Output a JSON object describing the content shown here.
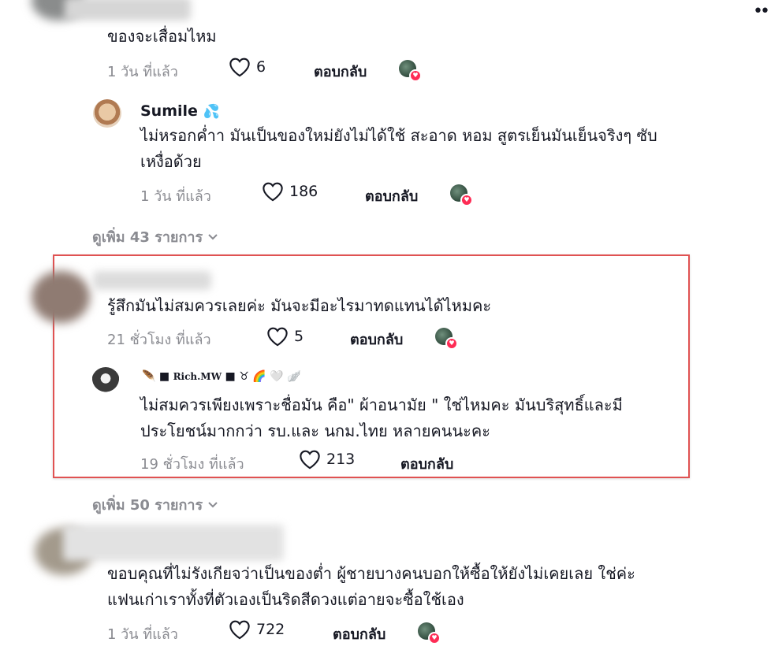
{
  "dots_label": "••",
  "comments": [
    {
      "text_lines": [
        "ของจะเสื่อมไหม"
      ],
      "time": "1 วัน ที่แล้ว",
      "likes": "6",
      "reply": "ตอบกลับ"
    },
    {
      "username": "Sumile",
      "username_emoji": "💦",
      "text_lines": [
        "ไม่หรอกค่ำา มันเป็นของใหม่ยังไม่ได้ใช้ สะอาด หอม สูตรเย็นมันเย็นจริงๆ ซับ",
        "เหงื่อด้วย"
      ],
      "time": "1 วัน ที่แล้ว",
      "likes": "186",
      "reply": "ตอบกลับ"
    },
    {
      "text_lines": [
        "รู้สึกมันไม่สมควรเลยค่ะ มันจะมีอะไรมาทดแทนได้ไหมคะ"
      ],
      "time": "21 ชั่วโมง ที่แล้ว",
      "likes": "5",
      "reply": "ตอบกลับ"
    },
    {
      "username_prefix": "🪶 ■",
      "username": "Rich.MW",
      "username_suffix": "■ ♉ 🌈 🤍 🪽",
      "text_lines": [
        "ไม่สมควรเพียงเพราะชื่อมัน คือ\" ผ้าอนามัย \" ใช่ไหมคะ มันบริสุทธิ์และมี",
        "ประโยชน์มากกว่า รบ.และ นกม.ไทย หลายคนนะคะ"
      ],
      "time": "19 ชั่วโมง ที่แล้ว",
      "likes": "213",
      "reply": "ตอบกลับ"
    },
    {
      "text_lines": [
        "ขอบคุณที่ไม่รังเกียจว่าเป็นของต่ำ ผู้ชายบางคนบอกให้ซื้อให้ยังไม่เคยเลย ใช่ค่ะ",
        "แฟนเก่าเราทั้งที่ตัวเองเป็นริดสีดวงแต่อายจะซื้อใช้เอง"
      ],
      "time": "1 วัน ที่แล้ว",
      "likes": "722",
      "reply": "ตอบกลับ"
    }
  ],
  "view_more": [
    "ดูเพิ่ม 43 รายการ",
    "ดูเพิ่ม 50 รายการ"
  ],
  "colors": {
    "highlight_border": "#e05252",
    "like_badge": "#fe2c55",
    "meta": "#8a8b91"
  }
}
